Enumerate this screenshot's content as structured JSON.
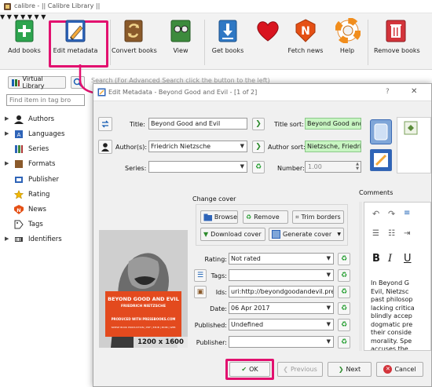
{
  "window": {
    "title": "calibre - || Calibre Library ||"
  },
  "toolbar": {
    "items": [
      {
        "label": "Add books"
      },
      {
        "label": "Edit metadata"
      },
      {
        "label": "Convert books"
      },
      {
        "label": "View"
      },
      {
        "label": "Get books"
      },
      {
        "label": "Fetch news"
      },
      {
        "label": "Help"
      },
      {
        "label": "Remove books"
      }
    ]
  },
  "search": {
    "virtual_library": "Virtual Library",
    "hint": "Search (For Advanced Search click the button to the left)",
    "tag_browser_placeholder": "Find item in tag bro"
  },
  "tag_browser": {
    "items": [
      "Authors",
      "Languages",
      "Series",
      "Formats",
      "Publisher",
      "Rating",
      "News",
      "Tags",
      "Identifiers"
    ]
  },
  "dialog": {
    "title": "Edit Metadata - Beyond Good and Evil - [1 of 2]",
    "help_glyph": "?",
    "close_glyph": "✕",
    "fields": {
      "title_label": "Title:",
      "title_value": "Beyond Good and Evil",
      "title_sort_label": "Title sort:",
      "title_sort_value": "Beyond Good and E",
      "authors_label": "Author(s):",
      "authors_value": "Friedrich Nietzsche",
      "author_sort_label": "Author sort:",
      "author_sort_value": "Nietzsche, Friedri",
      "series_label": "Series:",
      "series_value": "",
      "number_label": "Number:",
      "number_value": "1.00",
      "rating_label": "Rating:",
      "rating_value": "Not rated",
      "tags_label": "Tags:",
      "tags_value": "",
      "ids_label": "Ids:",
      "ids_value": "uri:http://beyondgoodandevil.pressb",
      "date_label": "Date:",
      "date_value": "06 Apr 2017",
      "published_label": "Published:",
      "published_value": "Undefined",
      "publisher_label": "Publisher:",
      "publisher_value": ""
    },
    "change_cover": {
      "heading": "Change cover",
      "browse": "Browse",
      "remove": "Remove",
      "trim": "Trim borders",
      "download": "Download cover",
      "generate": "Generate cover"
    },
    "cover": {
      "title": "BEYOND GOOD AND EVIL",
      "author": "FRIEDRICH NIETZSCHE",
      "publisher_line": "PRODUCED WITH PRESSBOOKS.COM",
      "tagline": "SIMPLE BOOK PRODUCTION | PDF | EPUB | MOBI | WEB",
      "size": "1200 x 1600"
    },
    "comments": {
      "heading": "Comments",
      "lines": [
        "In Beyond G",
        "Evil, Nietzsc",
        "past philosop",
        "lacking critica",
        "blindly accep",
        "dogmatic pre",
        "their conside",
        "morality. Spe",
        "accuses the"
      ]
    },
    "buttons": {
      "ok": "OK",
      "previous": "Previous",
      "next": "Next",
      "cancel": "Cancel"
    }
  },
  "colors": {
    "highlight": "#e2116f",
    "accent_blue": "#1a5fb4"
  }
}
